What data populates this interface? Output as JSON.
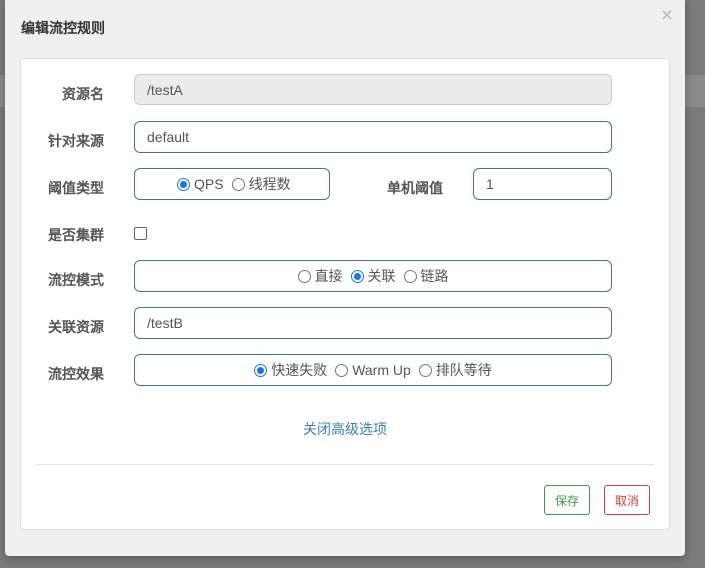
{
  "dialog": {
    "title": "编辑流控规则",
    "close_glyph": "×"
  },
  "form": {
    "resource_name": {
      "label": "资源名",
      "value": "/testA"
    },
    "limit_app": {
      "label": "针对来源",
      "value": "default"
    },
    "threshold_type": {
      "label": "阈值类型",
      "options": [
        {
          "label": "QPS",
          "selected": true
        },
        {
          "label": "线程数",
          "selected": false
        }
      ]
    },
    "single_threshold": {
      "label": "单机阈值",
      "value": "1"
    },
    "cluster_mode": {
      "label": "是否集群",
      "checked": false
    },
    "flow_mode": {
      "label": "流控模式",
      "options": [
        {
          "label": "直接",
          "selected": false
        },
        {
          "label": "关联",
          "selected": true
        },
        {
          "label": "链路",
          "selected": false
        }
      ]
    },
    "ref_resource": {
      "label": "关联资源",
      "value": "/testB"
    },
    "control_behavior": {
      "label": "流控效果",
      "options": [
        {
          "label": "快速失败",
          "selected": true
        },
        {
          "label": "Warm Up",
          "selected": false
        },
        {
          "label": "排队等待",
          "selected": false
        }
      ]
    },
    "advanced_toggle": "关闭高级选项"
  },
  "footer": {
    "save_label": "保存",
    "cancel_label": "取消"
  },
  "colors": {
    "accent": "#3c75a4",
    "save": "#3a9a4a",
    "cancel": "#d04040"
  }
}
